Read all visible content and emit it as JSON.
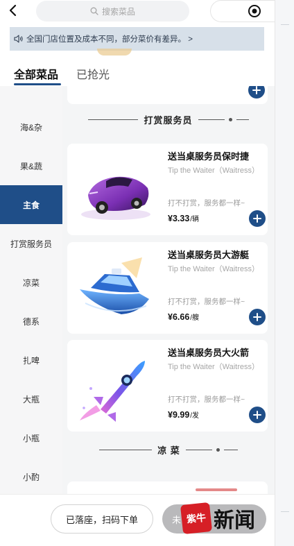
{
  "header": {
    "search_placeholder": "搜索菜品"
  },
  "notice": {
    "text": "全国门店位置及成本不同，部分菜价有差异。 >"
  },
  "tabs": [
    {
      "label": "全部菜品",
      "active": true
    },
    {
      "label": "已抢光",
      "active": false
    }
  ],
  "sidebar": {
    "items": [
      {
        "label": "海&杂"
      },
      {
        "label": "果&蔬"
      },
      {
        "label": "主食",
        "active": true
      },
      {
        "label": "打赏服务员"
      },
      {
        "label": "凉菜"
      },
      {
        "label": "德系"
      },
      {
        "label": "扎啤"
      },
      {
        "label": "大瓶"
      },
      {
        "label": "小瓶"
      },
      {
        "label": "小酌"
      }
    ]
  },
  "sections": {
    "tip": "打赏服务员",
    "cold": "凉 菜"
  },
  "products": [
    {
      "name": "送当桌服务员保时捷",
      "en": "Tip the Waiter（Waitress）",
      "desc": "打不打赏，服务都一样~",
      "price": "¥3.33",
      "unit": "/辆",
      "image": "purple-sports-car"
    },
    {
      "name": "送当桌服务员大游艇",
      "en": "Tip the Waiter（Waitress）",
      "desc": "打不打赏，服务都一样~",
      "price": "¥6.66",
      "unit": "/艘",
      "image": "blue-yacht"
    },
    {
      "name": "送当桌服务员大火箭",
      "en": "Tip the Waiter（Waitress）",
      "desc": "打不打赏，服务都一样~",
      "price": "¥9.99",
      "unit": "/发",
      "image": "blue-purple-rocket"
    }
  ],
  "bottom": {
    "seated_label": "已落座，扫码下单",
    "checkout_label": "未"
  },
  "watermark": {
    "logo": "紫牛",
    "text": "新闻"
  },
  "colors": {
    "brand": "#1f4e88",
    "notice_bg": "#d7e0e9",
    "sidebar_bg": "#f6f6f7"
  }
}
